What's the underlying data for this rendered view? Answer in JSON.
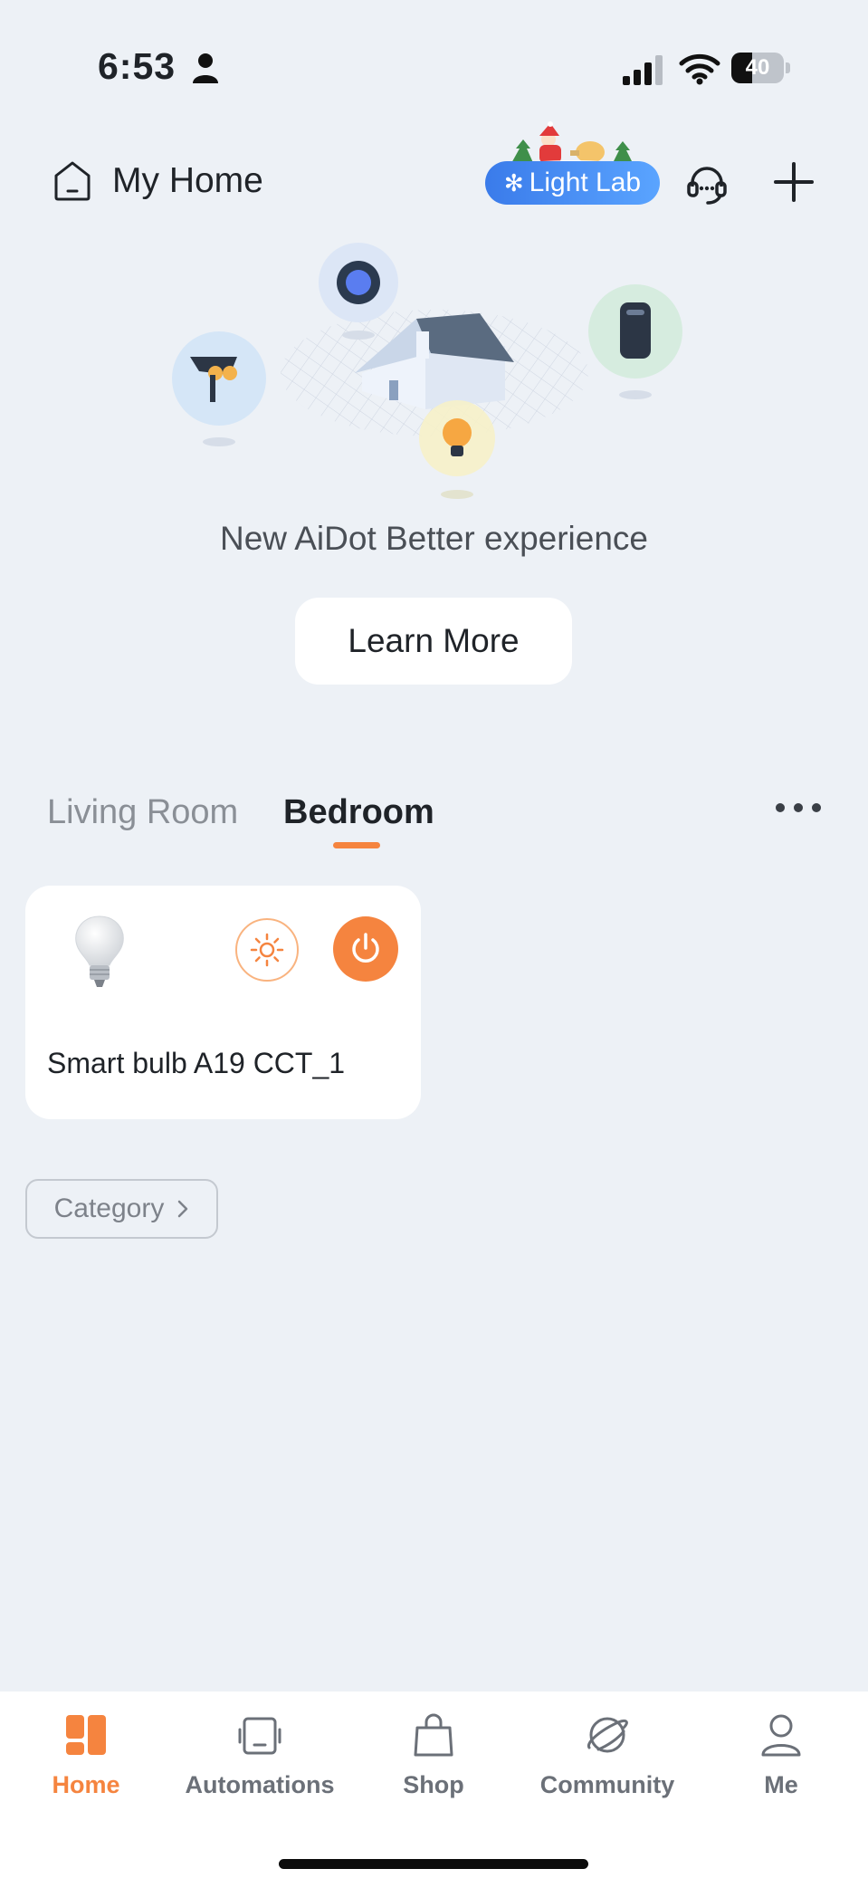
{
  "status_bar": {
    "time": "6:53",
    "battery_level": "40",
    "battery_fraction": 0.4,
    "icons": [
      "person-icon",
      "cellular-signal-icon",
      "wifi-icon",
      "battery-icon"
    ]
  },
  "header": {
    "home_name": "My Home",
    "light_lab_label": "Light Lab",
    "icons": [
      "home-icon",
      "headset-support-icon",
      "plus-icon"
    ]
  },
  "promo": {
    "text": "New AiDot Better experience",
    "button_label": "Learn More"
  },
  "rooms": {
    "tabs": [
      {
        "label": "Living Room",
        "active": false
      },
      {
        "label": "Bedroom",
        "active": true
      }
    ]
  },
  "devices": [
    {
      "name": "Smart bulb A19 CCT_1",
      "icon": "light-bulb-icon",
      "power": "on"
    }
  ],
  "category": {
    "label": "Category"
  },
  "bottom_nav": {
    "items": [
      {
        "label": "Home",
        "icon": "home-grid-icon",
        "active": true
      },
      {
        "label": "Automations",
        "icon": "automation-icon",
        "active": false
      },
      {
        "label": "Shop",
        "icon": "shopping-bag-icon",
        "active": false
      },
      {
        "label": "Community",
        "icon": "planet-icon",
        "active": false
      },
      {
        "label": "Me",
        "icon": "person-icon",
        "active": false
      }
    ]
  },
  "colors": {
    "accent": "#f5843f",
    "light_lab_blue": "#3a7bea",
    "background": "#edf1f6"
  }
}
